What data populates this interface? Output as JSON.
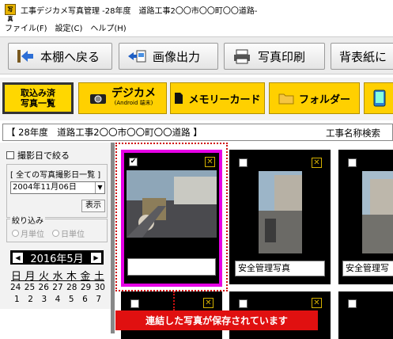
{
  "window": {
    "app_icon_text": "写真",
    "title": "工事デジカメ写真管理 -28年度　道路工事2〇〇市〇〇町〇〇道路-"
  },
  "menu": [
    "ファイル(F)",
    "設定(C)",
    "ヘルプ(H)"
  ],
  "toolbar": {
    "back_label": "本棚へ戻る",
    "export_label": "画像出力",
    "print_label": "写真印刷",
    "spine_label": "背表紙に"
  },
  "tabs": {
    "imported_line1": "取込み済",
    "imported_line2": "写真一覧",
    "camera_label": "デジカメ",
    "camera_sub": "(Android 端末)",
    "memory_label": "メモリーカード",
    "folder_label": "フォルダー"
  },
  "project_bar": {
    "text": "【 28年度　道路工事2〇〇市〇〇町〇〇道路 】",
    "search_label": "工事名称検索"
  },
  "sidebar": {
    "filter_by_date": "撮影日で絞る",
    "date_list_label": "[ 全ての写真撮影日一覧 ]",
    "selected_date": "2004年11月06日",
    "show_button": "表示",
    "narrow_label": "絞り込み",
    "by_month": "月単位",
    "by_day": "日単位",
    "calendar_title": "2016年5月",
    "weekdays": [
      "日",
      "月",
      "火",
      "水",
      "木",
      "金",
      "土"
    ],
    "week1": [
      "24",
      "25",
      "26",
      "27",
      "28",
      "29",
      "30"
    ],
    "week2": [
      "1",
      "2",
      "3",
      "4",
      "5",
      "6",
      "7"
    ]
  },
  "photos": [
    {
      "caption": "",
      "checked": true
    },
    {
      "caption": "安全管理写真",
      "checked": false
    },
    {
      "caption": "安全管理写",
      "checked": false
    }
  ],
  "callout": "連結した写真が保存されています",
  "colors": {
    "accent_yellow": "#ffd700",
    "highlight_magenta": "#e600e6",
    "callout_red": "#e01010"
  }
}
